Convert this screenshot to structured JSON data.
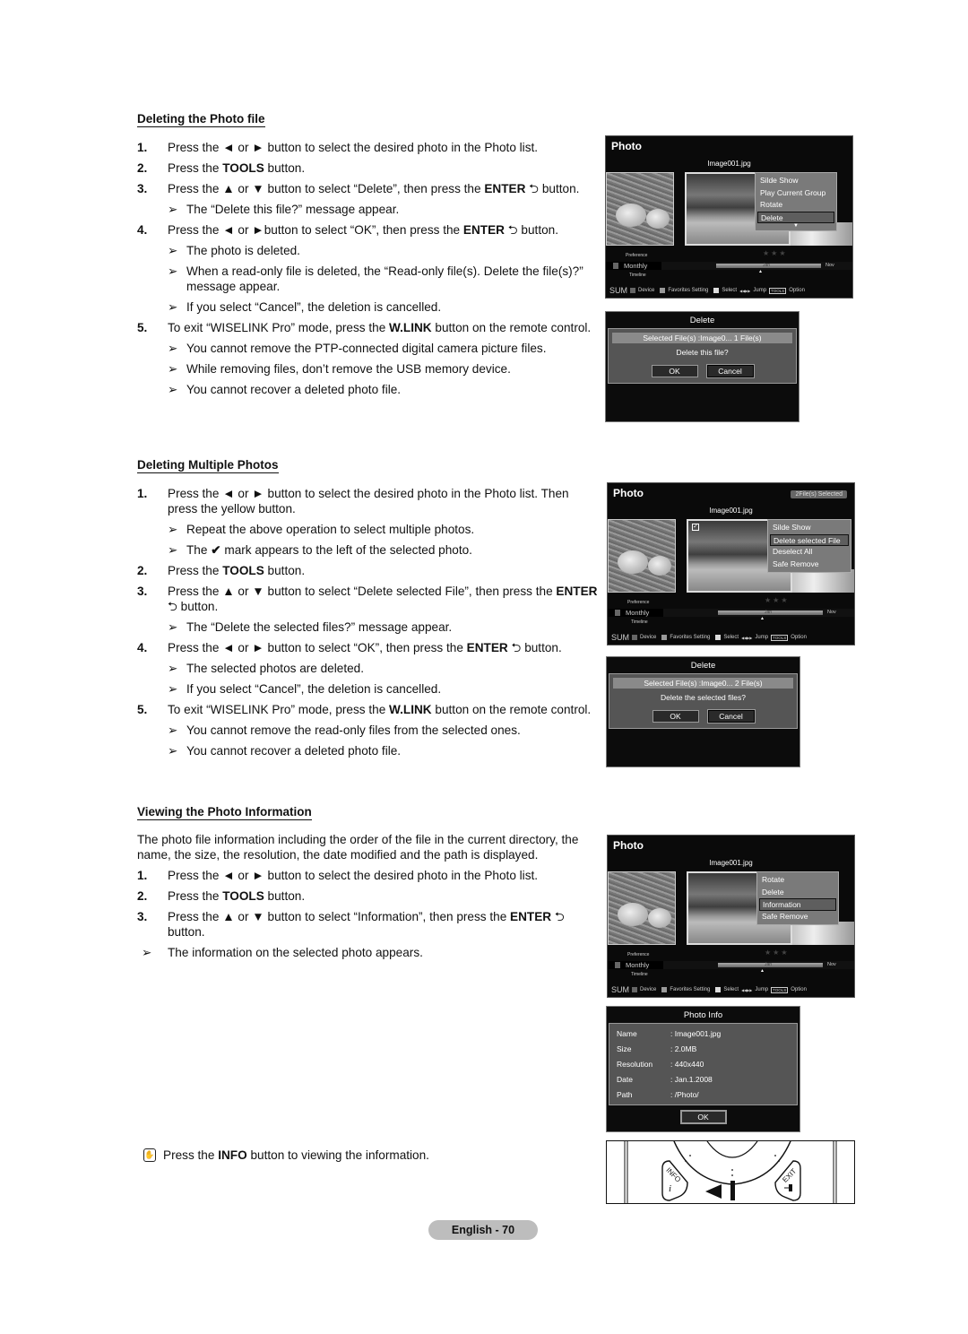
{
  "sections": [
    {
      "title": "Deleting the Photo file",
      "items": [
        {
          "type": "step",
          "num": "1.",
          "html": "Press the ◄ or ► button to select the desired photo in the Photo list."
        },
        {
          "type": "step",
          "num": "2.",
          "html": "Press the <b>TOOLS</b> button."
        },
        {
          "type": "step",
          "num": "3.",
          "html": "Press the ▲ or ▼ button to select “Delete”, then press the <b>ENTER</b> ⮌ button."
        },
        {
          "type": "note",
          "html": "The “Delete this file?” message appear."
        },
        {
          "type": "step",
          "num": "4.",
          "html": "Press the ◄ or ►button to select “OK”, then press the <b>ENTER</b> ⮌ button."
        },
        {
          "type": "note",
          "html": "The photo is deleted."
        },
        {
          "type": "note",
          "html": "When a read-only file is deleted, the “Read-only file(s). Delete the file(s)?” message appear."
        },
        {
          "type": "note",
          "html": "If you select “Cancel”, the deletion is cancelled."
        },
        {
          "type": "step",
          "num": "5.",
          "html": "To exit “WISELINK Pro” mode, press the <b>W.LINK</b> button on the remote control."
        },
        {
          "type": "note",
          "html": "You cannot remove the PTP-connected digital camera picture files."
        },
        {
          "type": "note",
          "html": "While removing files, don’t remove the USB memory device."
        },
        {
          "type": "note",
          "html": "You cannot recover a deleted photo file."
        }
      ]
    },
    {
      "title": "Deleting Multiple Photos",
      "items": [
        {
          "type": "step",
          "num": "1.",
          "html": "Press the ◄ or ► button to select the desired photo in the Photo list. Then press the yellow button."
        },
        {
          "type": "note",
          "html": "Repeat the above operation to select multiple photos."
        },
        {
          "type": "note",
          "html": "The <b>✔</b> mark appears to the left of the selected photo."
        },
        {
          "type": "step",
          "num": "2.",
          "html": "Press the <b>TOOLS</b> button."
        },
        {
          "type": "step",
          "num": "3.",
          "html": "Press the ▲ or ▼ button to select “Delete selected File”, then press the <b>ENTER</b> ⮌ button."
        },
        {
          "type": "note",
          "html": "The “Delete the selected files?” message appear."
        },
        {
          "type": "step",
          "num": "4.",
          "html": "Press the ◄ or ► button to select “OK”, then press the <b>ENTER</b> ⮌ button."
        },
        {
          "type": "note",
          "html": "The selected photos are deleted."
        },
        {
          "type": "note",
          "html": "If you select “Cancel”, the deletion is cancelled."
        },
        {
          "type": "step",
          "num": "5.",
          "html": "To exit “WISELINK Pro” mode, press the <b>W.LINK</b> button on the remote control."
        },
        {
          "type": "note",
          "html": "You cannot remove the read-only files from the selected ones."
        },
        {
          "type": "note",
          "html": "You cannot recover a deleted photo file."
        }
      ]
    },
    {
      "title": "Viewing the Photo Information",
      "items": [
        {
          "type": "para",
          "html": "The photo file information including the order of the file in the current directory, the name, the size, the resolution, the date modified and the path is displayed."
        },
        {
          "type": "step",
          "num": "1.",
          "html": "Press the ◄ or ► button to select the desired photo in the Photo list."
        },
        {
          "type": "step",
          "num": "2.",
          "html": "Press the <b>TOOLS</b> button."
        },
        {
          "type": "step",
          "num": "3.",
          "html": "Press the ▲ or ▼ button to select “Information”, then press the <b>ENTER</b> ⮌ button."
        },
        {
          "type": "topnote",
          "html": "The information on the selected photo appears."
        }
      ]
    }
  ],
  "arrow_glyph": "➢",
  "info_tip": {
    "icon": "remote-hand-icon",
    "html": "Press the <b>INFO</b> button to viewing the information."
  },
  "screens": [
    {
      "title": "Photo",
      "badge": "",
      "filename": "Image001.jpg",
      "checked": false,
      "menu": [
        "Silde Show",
        "Play Current Group",
        "Rotate",
        "Delete"
      ],
      "menu_selected": 3,
      "menu_more": true,
      "preference": "Preference",
      "monthly": "Monthly",
      "timeline": "Timeline",
      "bar_label": "Jan",
      "next_month": "Nov",
      "footer": {
        "sum": "SUM",
        "device": "Device",
        "favorites": "Favorites Setting",
        "select": "Select",
        "jump": "Jump",
        "tools": "TOOLS",
        "option": "Option"
      }
    },
    {
      "title": "Photo",
      "badge": "2File(s) Selected",
      "filename": "Image001.jpg",
      "checked": true,
      "menu": [
        "Silde Show",
        "Delete selected File",
        "Deselect All",
        "Safe Remove"
      ],
      "menu_selected": 1,
      "menu_more": false,
      "preference": "Preference",
      "monthly": "Monthly",
      "timeline": "Timeline",
      "bar_label": "Jan",
      "next_month": "Nov",
      "footer": {
        "sum": "SUM",
        "device": "Device",
        "favorites": "Favorites Setting",
        "select": "Select",
        "jump": "Jump",
        "tools": "TOOLS",
        "option": "Option"
      }
    },
    {
      "title": "Photo",
      "badge": "",
      "filename": "Image001.jpg",
      "checked": false,
      "menu": [
        "Rotate",
        "Delete",
        "Information",
        "Safe Remove"
      ],
      "menu_selected": 2,
      "menu_more": false,
      "preference": "Preference",
      "monthly": "Monthly",
      "timeline": "Timeline",
      "bar_label": "Jan",
      "next_month": "Nov",
      "footer": {
        "sum": "SUM",
        "device": "Device",
        "favorites": "Favorites Setting",
        "select": "Select",
        "jump": "Jump",
        "tools": "TOOLS",
        "option": "Option"
      }
    }
  ],
  "dialogs": {
    "delete_one": {
      "title": "Delete",
      "selected": "Selected File(s) :Image0...   1 File(s)",
      "message": "Delete this file?",
      "ok": "OK",
      "cancel": "Cancel"
    },
    "delete_multi": {
      "title": "Delete",
      "selected": "Selected File(s) :Image0...   2 File(s)",
      "message": "Delete the selected files?",
      "ok": "OK",
      "cancel": "Cancel"
    },
    "photo_info": {
      "title": "Photo Info",
      "rows": [
        {
          "key": "Name",
          "value": ": Image001.jpg"
        },
        {
          "key": "Size",
          "value": ": 2.0MB"
        },
        {
          "key": "Resolution",
          "value": ": 440x440"
        },
        {
          "key": "Date",
          "value": ": Jan.1.2008"
        },
        {
          "key": "Path",
          "value": ": /Photo/"
        }
      ],
      "ok": "OK"
    }
  },
  "remote": {
    "info_label": "INFO",
    "exit_label": "EXIT"
  },
  "page_footer": "English - 70"
}
